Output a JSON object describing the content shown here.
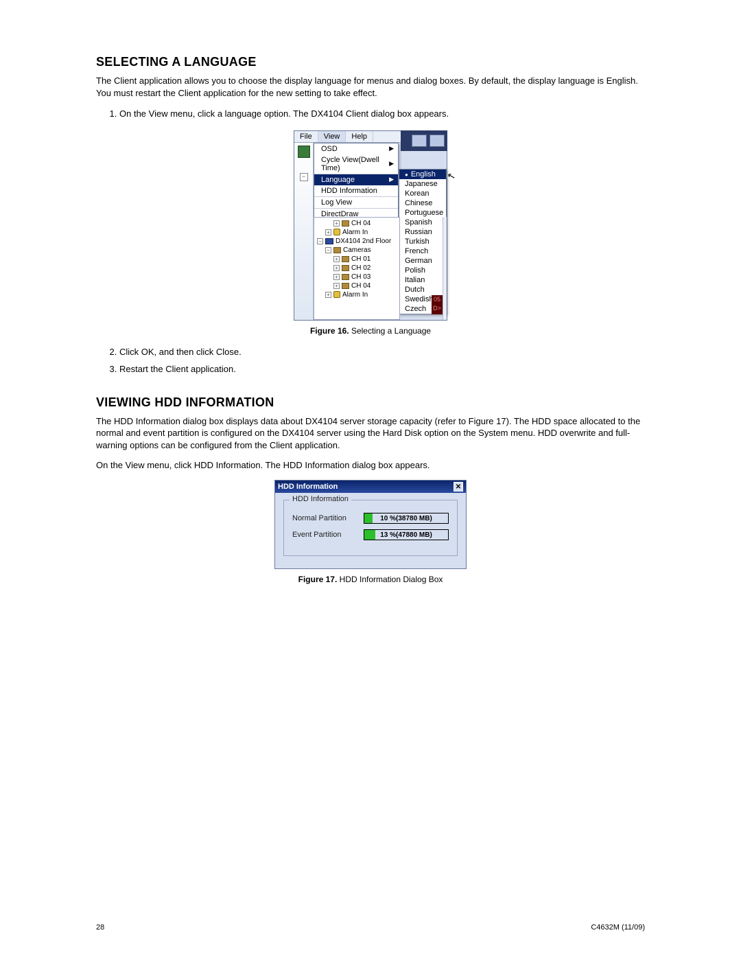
{
  "section1": {
    "heading": "SELECTING A LANGUAGE",
    "intro": "The Client application allows you to choose the display language for menus and dialog boxes. By default, the display language is English. You must restart the Client application for the new setting to take effect.",
    "step1": "On the View menu, click a language option. The DX4104 Client dialog box appears.",
    "step2": "Click OK, and then click Close.",
    "step3": "Restart the Client application."
  },
  "figure16": {
    "caption_label": "Figure 16.",
    "caption_text": "  Selecting a Language",
    "menubar": {
      "file": "File",
      "view": "View",
      "help": "Help"
    },
    "view_menu": {
      "osd": "OSD",
      "cycle": "Cycle View(Dwell Time)",
      "language": "Language",
      "hdd": "HDD Information",
      "log": "Log View",
      "directdraw": "DirectDraw"
    },
    "languages": [
      "English",
      "Japanese",
      "Korean",
      "Chinese",
      "Portuguese",
      "Spanish",
      "Russian",
      "Turkish",
      "French",
      "German",
      "Polish",
      "Italian",
      "Dutch",
      "Swedish",
      "Czech"
    ],
    "tree": {
      "ch04a": "CH 04",
      "alarm1": "Alarm In",
      "server": "DX4104 2nd Floor",
      "cameras": "Cameras",
      "ch01": "CH 01",
      "ch02": "CH 02",
      "ch03": "CH 03",
      "ch04b": "CH 04",
      "alarm2": "Alarm In"
    },
    "vbar": {
      "l1": "05",
      "l2": "D>"
    }
  },
  "section2": {
    "heading": "VIEWING HDD INFORMATION",
    "para1": "The HDD Information dialog box displays data about DX4104 server storage capacity (refer to Figure 17). The HDD space allocated to the normal and event partition is configured on the DX4104 server using the Hard Disk option on the System menu. HDD overwrite and full-warning options can be configured from the Client application.",
    "para2": "On the View menu, click HDD Information. The HDD Information dialog box appears."
  },
  "figure17": {
    "caption_label": "Figure 17.",
    "caption_text": "  HDD Information Dialog Box",
    "title": "HDD Information",
    "group_label": "HDD Information",
    "normal_label": "Normal Partition",
    "normal_value": "10 %(38780 MB)",
    "normal_fill_pct": 10,
    "event_label": "Event Partition",
    "event_value": "13 %(47880 MB)",
    "event_fill_pct": 13
  },
  "footer": {
    "page": "28",
    "doc": "C4632M (11/09)"
  }
}
